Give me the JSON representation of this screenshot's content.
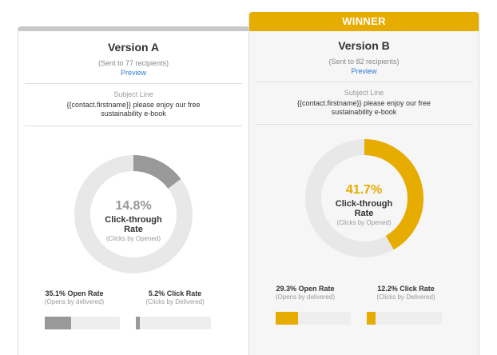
{
  "colors": {
    "winner": "#e6ac00",
    "neutral": "#999999",
    "track": "#e8e8e8",
    "link": "#2b7bd6"
  },
  "version_a": {
    "title": "Version A",
    "sent": "(Sent to 77 recipients)",
    "preview": "Preview",
    "subject_label": "Subject Line",
    "subject": "{{contact.firstname}} please enjoy our free sustainability e-book",
    "ctr_text": "14.8%",
    "ctr_value": 14.8,
    "ctr_label": "Click-through Rate",
    "ctr_sub": "(Clicks by Opened)",
    "open_rate_label": "35.1% Open Rate",
    "open_rate_value": 35.1,
    "open_rate_sub": "(Opens by delivered)",
    "click_rate_label": "5.2% Click Rate",
    "click_rate_value": 5.2,
    "click_rate_sub": "(Clicks by Delivered)"
  },
  "version_b": {
    "badge": "WINNER",
    "title": "Version B",
    "sent": "(Sent to 82 recipients)",
    "preview": "Preview",
    "subject_label": "Subject Line",
    "subject": "{{contact.firstname}} please enjoy our free sustainability e-book",
    "ctr_text": "41.7%",
    "ctr_value": 41.7,
    "ctr_label": "Click-through Rate",
    "ctr_sub": "(Clicks by Opened)",
    "open_rate_label": "29.3% Open Rate",
    "open_rate_value": 29.3,
    "open_rate_sub": "(Opens by delivered)",
    "click_rate_label": "12.2% Click Rate",
    "click_rate_value": 12.2,
    "click_rate_sub": "(Clicks by Delivered)"
  }
}
